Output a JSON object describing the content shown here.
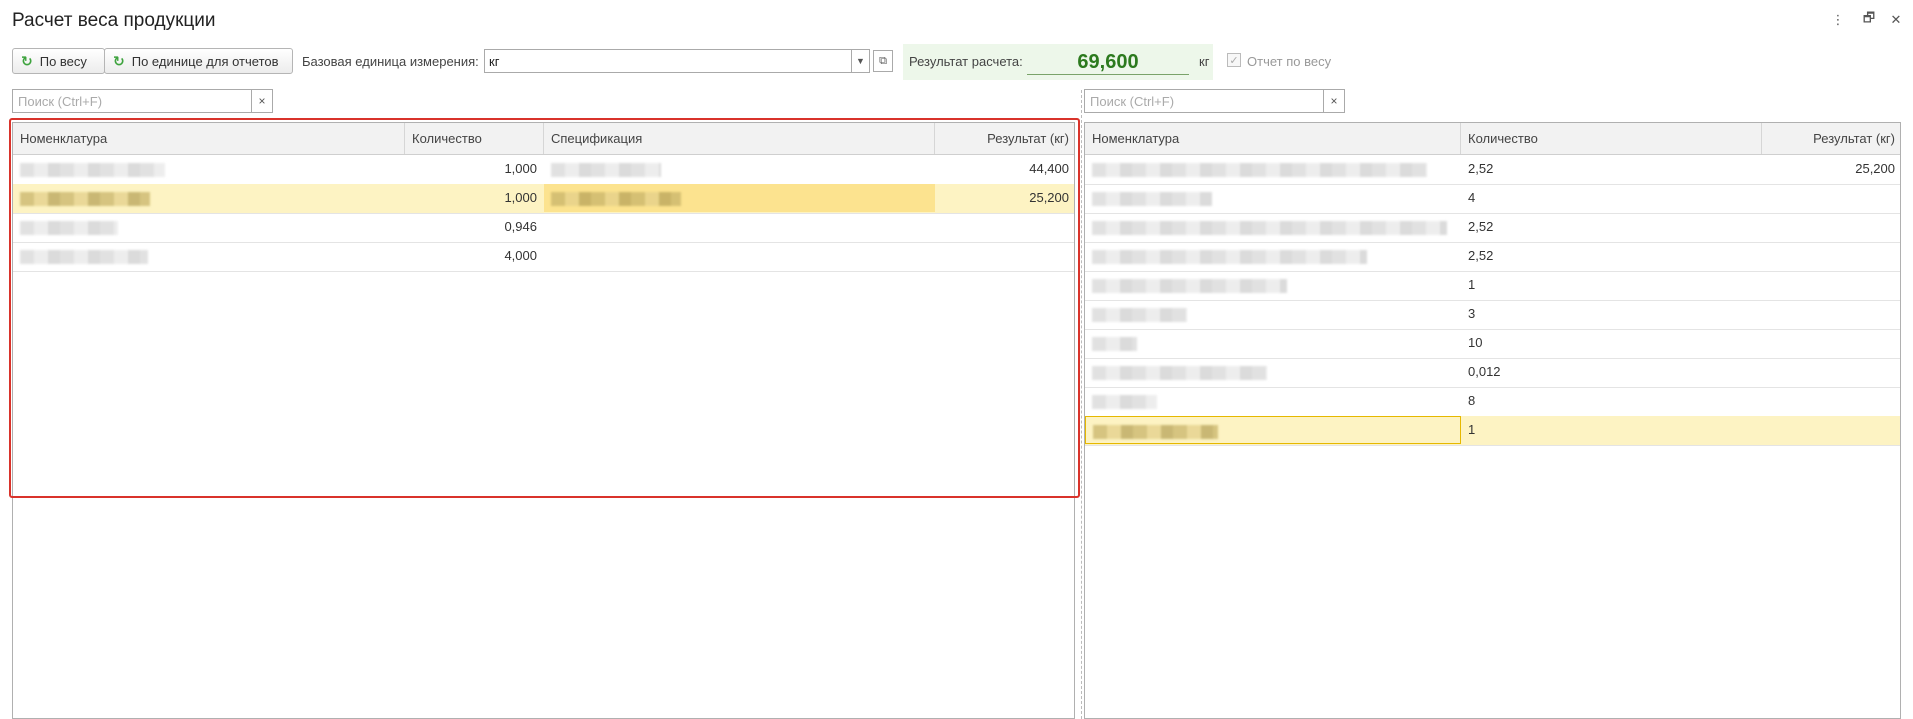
{
  "window": {
    "title": "Расчет веса продукции",
    "menu_icon": "⋮",
    "restore_icon": "🗗",
    "close_icon": "✕"
  },
  "toolbar": {
    "by_weight_label": "По весу",
    "by_unit_label": "По единице для отчетов",
    "base_unit_label": "Базовая единица измерения:",
    "base_unit_value": "кг",
    "result_label": "Результат расчета:",
    "result_value": "69,600",
    "result_unit": "кг",
    "report_by_weight_label": "Отчет по весу",
    "report_by_weight_checked": true
  },
  "left_search": {
    "placeholder": "Поиск (Ctrl+F)",
    "clear": "×"
  },
  "right_search": {
    "placeholder": "Поиск (Ctrl+F)",
    "clear": "×"
  },
  "left_table": {
    "columns": [
      "Номенклатура",
      "Количество",
      "Спецификация",
      "Результат (кг)"
    ],
    "rows": [
      {
        "qty": "1,000",
        "result": "44,400"
      },
      {
        "qty": "1,000",
        "result": "25,200"
      },
      {
        "qty": "0,946",
        "result": ""
      },
      {
        "qty": "4,000",
        "result": ""
      }
    ]
  },
  "right_table": {
    "columns": [
      "Номенклатура",
      "Количество",
      "Результат (кг)"
    ],
    "rows": [
      {
        "qty": "2,52",
        "result": "25,200"
      },
      {
        "qty": "4",
        "result": ""
      },
      {
        "qty": "2,52",
        "result": ""
      },
      {
        "qty": "2,52",
        "result": ""
      },
      {
        "qty": "1",
        "result": ""
      },
      {
        "qty": "3",
        "result": ""
      },
      {
        "qty": "10",
        "result": ""
      },
      {
        "qty": "0,012",
        "result": ""
      },
      {
        "qty": "8",
        "result": ""
      },
      {
        "qty": "1",
        "result": ""
      }
    ]
  },
  "colors": {
    "accent_green": "#2c7a1e",
    "selection": "#fdf3c3",
    "highlight_frame": "#d9332b"
  }
}
